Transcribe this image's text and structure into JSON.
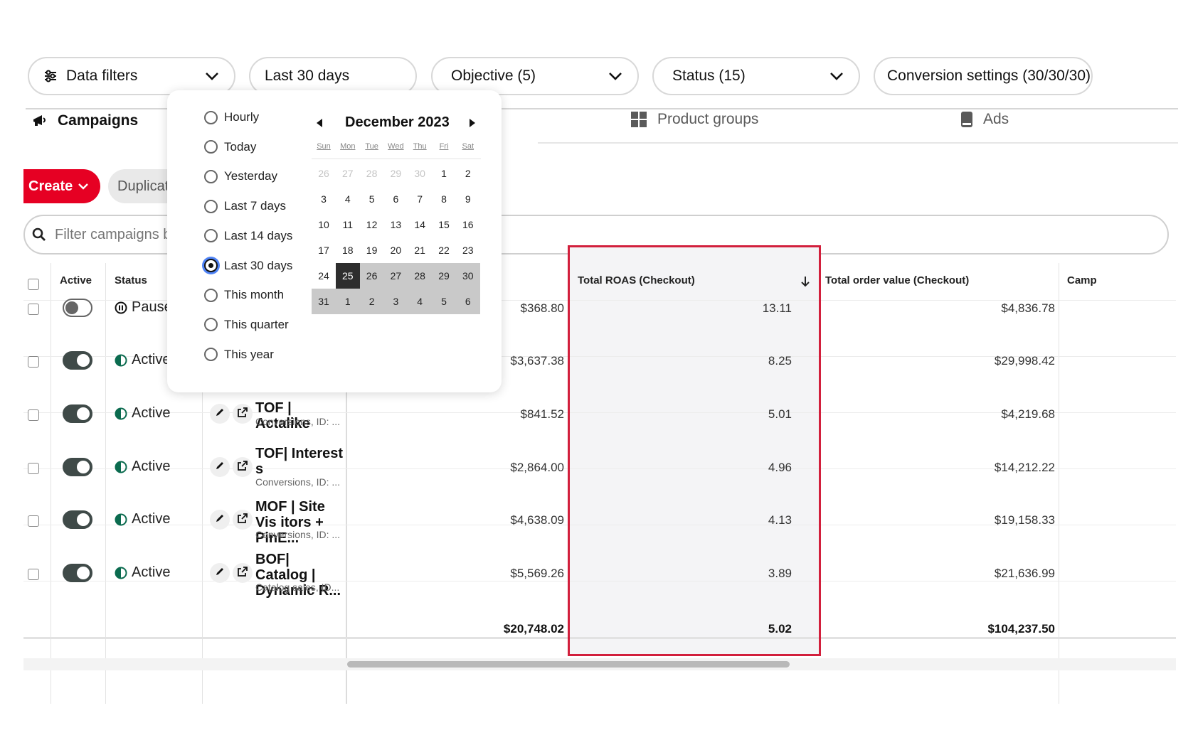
{
  "filters": {
    "data_filters": "Data filters",
    "date_range": "Last 30 days",
    "objective": "Objective (5)",
    "status": "Status (15)",
    "conversion": "Conversion settings (30/30/30)"
  },
  "tabs": {
    "campaigns": "Campaigns",
    "product_groups": "Product groups",
    "ads": "Ads"
  },
  "actions": {
    "create": "Create",
    "duplicate": "Duplicate"
  },
  "search": {
    "placeholder": "Filter campaigns by"
  },
  "table": {
    "headers": {
      "active": "Active",
      "status": "Status",
      "roas": "Total ROAS (Checkout)",
      "order_value": "Total order value (Checkout)",
      "campaign_cut": "Camp"
    },
    "rows": [
      {
        "active": false,
        "status": "Pause",
        "name": "",
        "sub": "",
        "spend": "$368.80",
        "roas": "13.11",
        "order_value": "$4,836.78"
      },
      {
        "active": true,
        "status": "Active",
        "name": "",
        "sub": "",
        "spend": "$3,637.38",
        "roas": "8.25",
        "order_value": "$29,998.42"
      },
      {
        "active": true,
        "status": "Active",
        "name": "TOF | Actalike",
        "sub": "Conversions, ID: ...",
        "spend": "$841.52",
        "roas": "5.01",
        "order_value": "$4,219.68"
      },
      {
        "active": true,
        "status": "Active",
        "name": "TOF| Interest s",
        "sub": "Conversions, ID: ...",
        "spend": "$2,864.00",
        "roas": "4.96",
        "order_value": "$14,212.22"
      },
      {
        "active": true,
        "status": "Active",
        "name": "MOF | Site Vis itors + PinE...",
        "sub": "Conversions, ID: ...",
        "spend": "$4,638.09",
        "roas": "4.13",
        "order_value": "$19,158.33"
      },
      {
        "active": true,
        "status": "Active",
        "name": "BOF| Catalog | Dynamic R...",
        "sub": "Catalog sales, ID...",
        "spend": "$5,569.26",
        "roas": "3.89",
        "order_value": "$21,636.99"
      }
    ],
    "totals": {
      "spend": "$20,748.02",
      "roas": "5.02",
      "order_value": "$104,237.50"
    }
  },
  "date_picker": {
    "options": [
      "Hourly",
      "Today",
      "Yesterday",
      "Last 7 days",
      "Last 14 days",
      "Last 30 days",
      "This month",
      "This quarter",
      "This year"
    ],
    "selected": "Last 30 days",
    "month_title": "December 2023",
    "weekdays": [
      "Sun",
      "Mon",
      "Tue",
      "Wed",
      "Thu",
      "Fri",
      "Sat"
    ],
    "weeks": [
      [
        "26",
        "27",
        "28",
        "29",
        "30",
        "1",
        "2"
      ],
      [
        "3",
        "4",
        "5",
        "6",
        "7",
        "8",
        "9"
      ],
      [
        "10",
        "11",
        "12",
        "13",
        "14",
        "15",
        "16"
      ],
      [
        "17",
        "18",
        "19",
        "20",
        "21",
        "22",
        "23"
      ],
      [
        "24",
        "25",
        "26",
        "27",
        "28",
        "29",
        "30"
      ],
      [
        "31",
        "1",
        "2",
        "3",
        "4",
        "5",
        "6"
      ]
    ],
    "range_start": "25"
  },
  "colors": {
    "brand_red": "#e60023",
    "highlight_border": "#d21f3c",
    "status_active": "#0b6b4f",
    "toggle_on": "#3f4a48",
    "range_fill": "#c9c9c9",
    "range_start": "#2d2d2d"
  }
}
